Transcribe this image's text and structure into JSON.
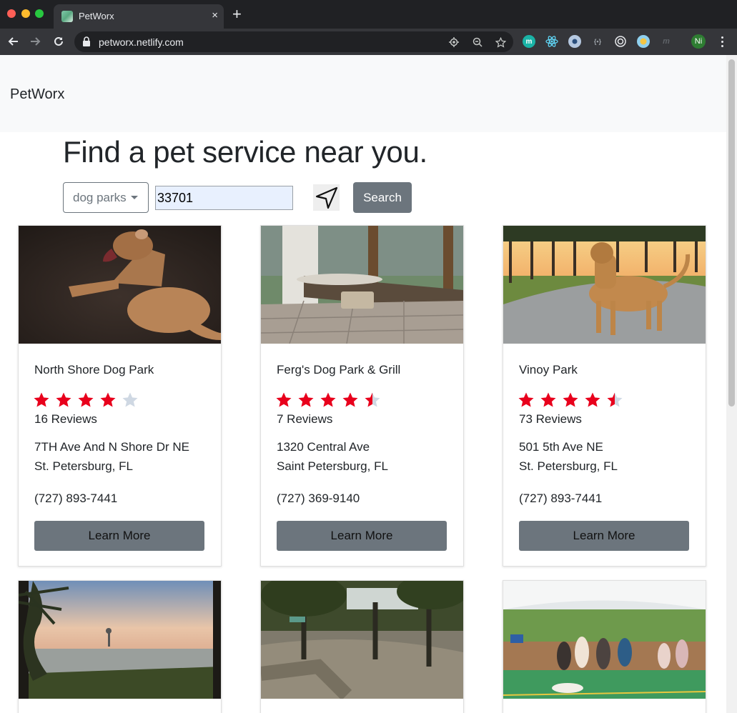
{
  "browser": {
    "tab_title": "PetWorx",
    "new_tab_symbol": "+",
    "close_symbol": "×",
    "url": "petworx.netlify.com",
    "profile_initials": "Ni"
  },
  "navbar": {
    "brand": "PetWorx"
  },
  "hero": {
    "headline": "Find a pet service near you."
  },
  "search": {
    "category_selected": "dog parks",
    "zip_value": "33701",
    "button_label": "Search"
  },
  "colors": {
    "star_filled": "#e8001c",
    "star_empty": "#cfd8e3",
    "button_gray": "#6c757d"
  },
  "cards": [
    {
      "name": "North Shore Dog Park",
      "rating": 4,
      "reviews": "16 Reviews",
      "address_line1": "7TH Ave And N Shore Dr NE",
      "address_line2": "St. Petersburg, FL",
      "phone": "(727) 893-7441",
      "button": "Learn More"
    },
    {
      "name": "Ferg's Dog Park & Grill",
      "rating": 4.5,
      "reviews": "7 Reviews",
      "address_line1": "1320 Central Ave",
      "address_line2": "Saint Petersburg, FL",
      "phone": "(727) 369-9140",
      "button": "Learn More"
    },
    {
      "name": "Vinoy Park",
      "rating": 4.5,
      "reviews": "73 Reviews",
      "address_line1": "501 5th Ave NE",
      "address_line2": "St. Petersburg, FL",
      "phone": "(727) 893-7441",
      "button": "Learn More"
    }
  ]
}
